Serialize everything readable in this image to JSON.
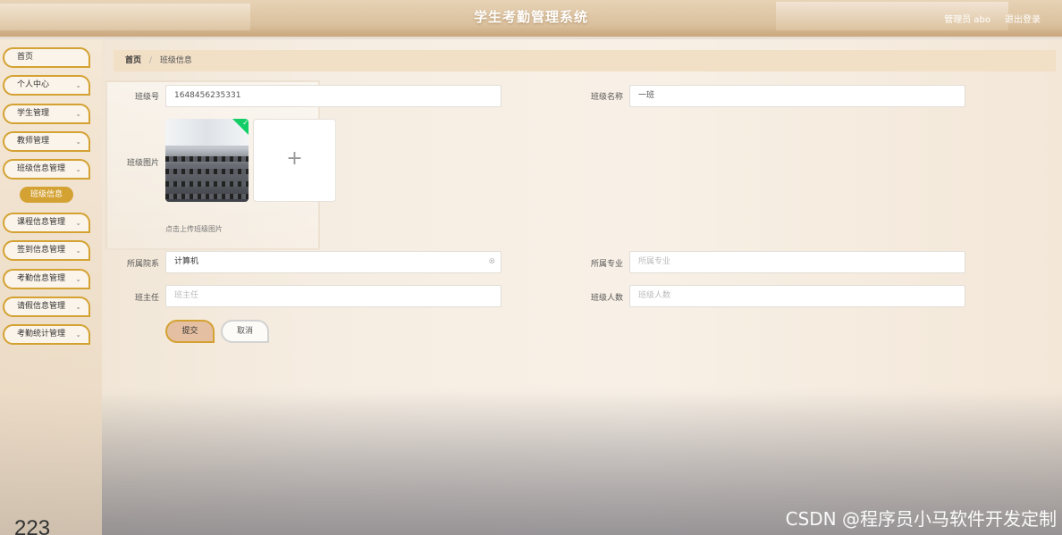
{
  "header": {
    "title": "学生考勤管理系统",
    "user": "管理员 abo",
    "logout": "退出登录"
  },
  "sidebar": {
    "items": [
      {
        "label": "首页",
        "has_chevron": false
      },
      {
        "label": "个人中心",
        "has_chevron": true
      },
      {
        "label": "学生管理",
        "has_chevron": true
      },
      {
        "label": "教师管理",
        "has_chevron": true
      },
      {
        "label": "班级信息管理",
        "has_chevron": true
      },
      {
        "label": "课程信息管理",
        "has_chevron": true
      },
      {
        "label": "签到信息管理",
        "has_chevron": true
      },
      {
        "label": "考勤信息管理",
        "has_chevron": true
      },
      {
        "label": "请假信息管理",
        "has_chevron": true
      },
      {
        "label": "考勤统计管理",
        "has_chevron": true
      }
    ],
    "active_submenu": "班级信息",
    "chevron_glyph": "⌄",
    "corner_text": "223"
  },
  "breadcrumb": {
    "home": "首页",
    "separator": "/",
    "current": "班级信息"
  },
  "form": {
    "class_no": {
      "label": "班级号",
      "value": "1648456235331"
    },
    "class_name": {
      "label": "班级名称",
      "value": "一班"
    },
    "class_image": {
      "label": "班级图片",
      "tip": "点击上传班级图片",
      "add_icon": "+",
      "uploaded_check": "✓"
    },
    "department": {
      "label": "所属院系",
      "value": "计算机",
      "clear_icon": "⊗"
    },
    "major": {
      "label": "所属专业",
      "placeholder": "所属专业"
    },
    "head_teacher": {
      "label": "班主任",
      "placeholder": "班主任"
    },
    "student_count": {
      "label": "班级人数",
      "placeholder": "班级人数"
    },
    "submit_label": "提交",
    "cancel_label": "取消"
  },
  "watermark": "CSDN @程序员小马软件开发定制",
  "colors": {
    "accent": "#d4a233",
    "submit_bg": "#e5bfa1",
    "breadcrumb_bg": "#f1dfc6",
    "success": "#13ce66"
  }
}
